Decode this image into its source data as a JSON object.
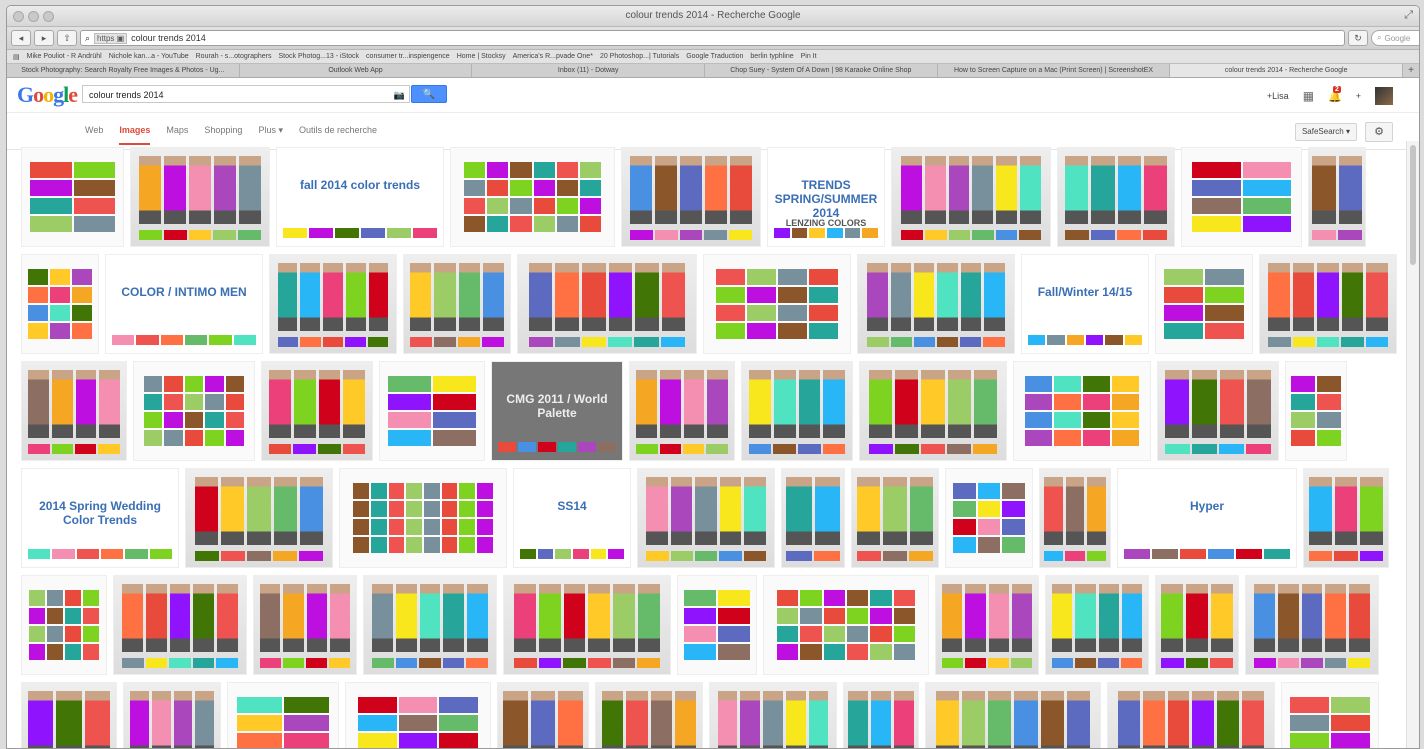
{
  "window": {
    "title": "colour trends 2014 - Recherche Google",
    "dots": "○ ○ ○"
  },
  "toolbar": {
    "back": "◂",
    "forward": "▸",
    "share": "⇧",
    "address_chip": "https ▣",
    "address": "colour trends 2014",
    "reload": "↻",
    "search_placeholder": "Google"
  },
  "bookmarks": [
    "Mike Pouliot - R Andrühl",
    "Nichole kan...a - YouTube",
    "Rourah - s...otographers",
    "Stock Photog...13 - iStock",
    "consumer tr...inspiengence",
    "Home | Stocksy",
    "America's R...pvade One*",
    "20 Photoshop...| Tutorials",
    "Google Traduction",
    "berlin typhline",
    "Pin It"
  ],
  "tabs": [
    {
      "label": "Stock Photography: Search Royalty Free Images & Photos - Ug...",
      "active": false
    },
    {
      "label": "Outlook Web App",
      "active": false
    },
    {
      "label": "Inbox (11) - Dotway",
      "active": false
    },
    {
      "label": "Chop Suey - System Of A Down | 98 Karaoke Online Shop",
      "active": false
    },
    {
      "label": "How to Screen Capture on a Mac (Print Screen) | ScreenshotEX",
      "active": false
    },
    {
      "label": "colour trends 2014 - Recherche Google",
      "active": true
    }
  ],
  "google": {
    "logo": "Google",
    "query": "colour trends 2014",
    "search_icon": "🔍",
    "camera_icon": "📷",
    "user": "+Lisa",
    "apps_icon": "▦",
    "notif_count": "2",
    "share_icon": "+",
    "nav": [
      {
        "label": "Web",
        "active": false
      },
      {
        "label": "Images",
        "active": true
      },
      {
        "label": "Maps",
        "active": false
      },
      {
        "label": "Shopping",
        "active": false
      },
      {
        "label": "Plus ▾",
        "active": false
      },
      {
        "label": "Outils de recherche",
        "active": false
      }
    ],
    "safesearch": "SafeSearch ▾",
    "gear": "⚙"
  },
  "captions": {
    "trends": "TRENDS SPRING/SUMMER 2014",
    "lenzing": "LENZING COLORS",
    "fall": "fall 2014 color trends",
    "color_intimo": "COLOR / INTIMO MEN",
    "cmg": "CMG 2011 / World Palette",
    "wedding": "2014 Spring Wedding Color Trends",
    "ss14": "SS14",
    "hyper": "Hyper",
    "fw": "Fall/Winter 14/15"
  },
  "colors": {
    "accent": "#4d90fe",
    "nav_active": "#dd4b39",
    "palette": [
      "#e84a3c",
      "#f5a623",
      "#f8e71c",
      "#7ed321",
      "#4a90e2",
      "#9013fe",
      "#bd10e0",
      "#50e3c2",
      "#d0021b",
      "#8b572a",
      "#417505",
      "#f48fb1",
      "#26a69a",
      "#ffca28",
      "#5c6bc0",
      "#ef5350",
      "#ab47bc",
      "#29b6f6",
      "#9ccc65",
      "#ff7043",
      "#8d6e63",
      "#78909c",
      "#ec407a",
      "#66bb6a"
    ]
  }
}
